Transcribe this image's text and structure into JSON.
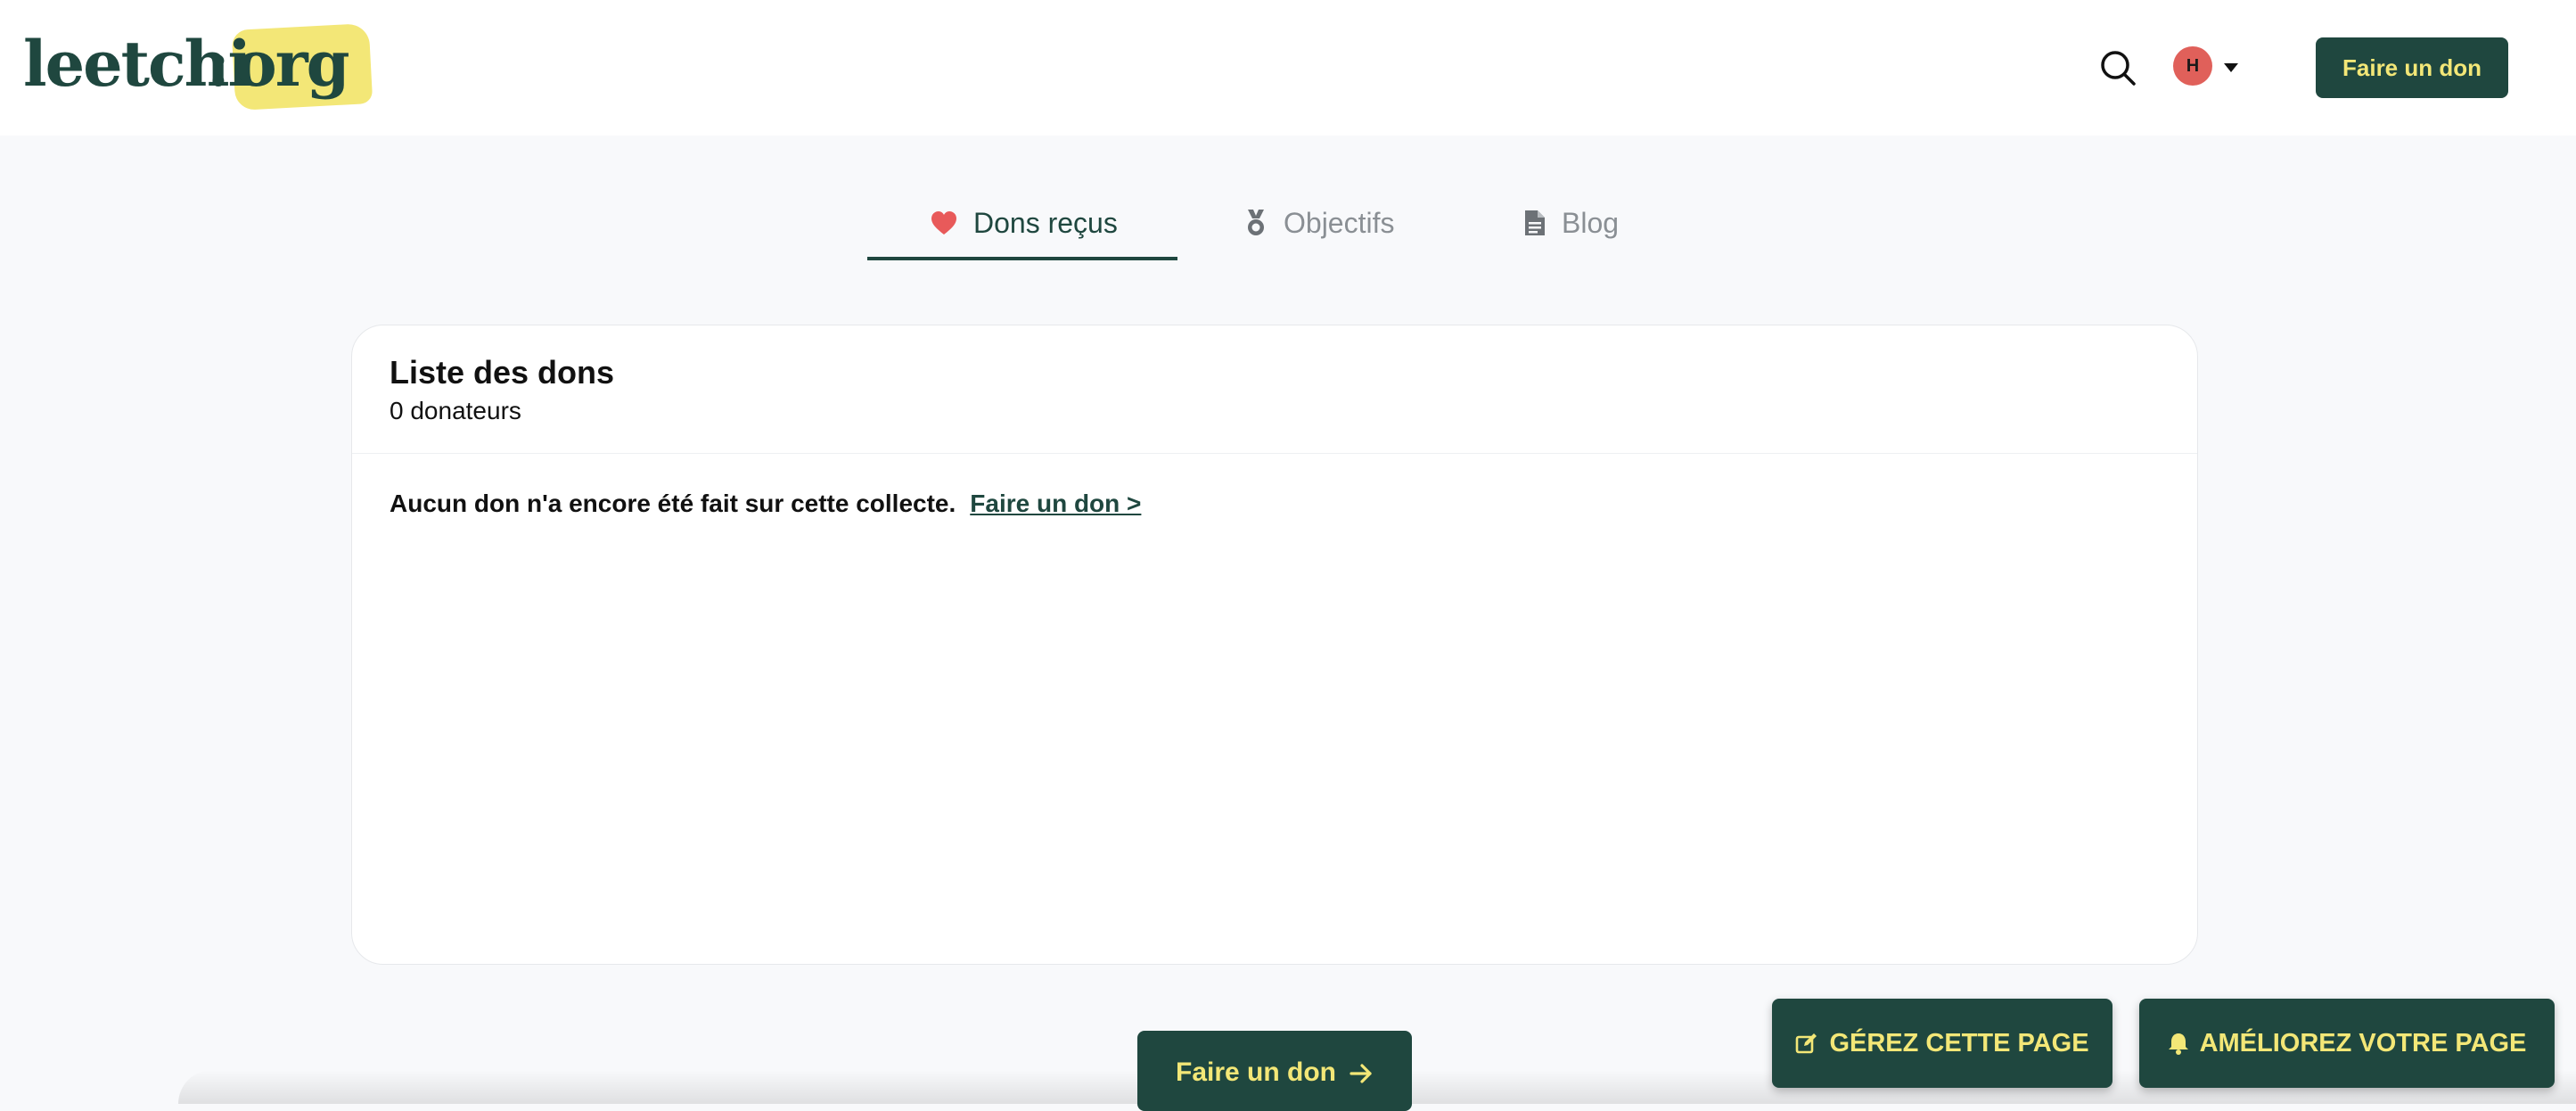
{
  "header": {
    "logo": {
      "word": "leetchi",
      "colon": ":",
      "suffix": "org"
    },
    "avatar_initial": "H",
    "donate_button": "Faire un don"
  },
  "tabs": [
    {
      "label": "Dons reçus",
      "icon": "heart-icon",
      "active": true
    },
    {
      "label": "Objectifs",
      "icon": "medal-icon",
      "active": false
    },
    {
      "label": "Blog",
      "icon": "document-icon",
      "active": false
    }
  ],
  "card": {
    "title": "Liste des dons",
    "subtitle": "0 donateurs",
    "empty_message": "Aucun don n'a encore été fait sur cette collecte.",
    "empty_link": "Faire un don >"
  },
  "bottom_button": {
    "label": "Faire un don",
    "icon": "arrow-right-icon"
  },
  "floating_buttons": {
    "manage": {
      "label": "GÉREZ CETTE PAGE",
      "icon": "edit-icon"
    },
    "improve": {
      "label": "AMÉLIOREZ VOTRE PAGE",
      "icon": "bell-icon"
    }
  },
  "colors": {
    "brand_dark": "#1f473f",
    "brand_yellow": "#f3e777",
    "heart": "#e85a5a",
    "avatar": "#e0605a",
    "muted": "#8a8f94"
  }
}
